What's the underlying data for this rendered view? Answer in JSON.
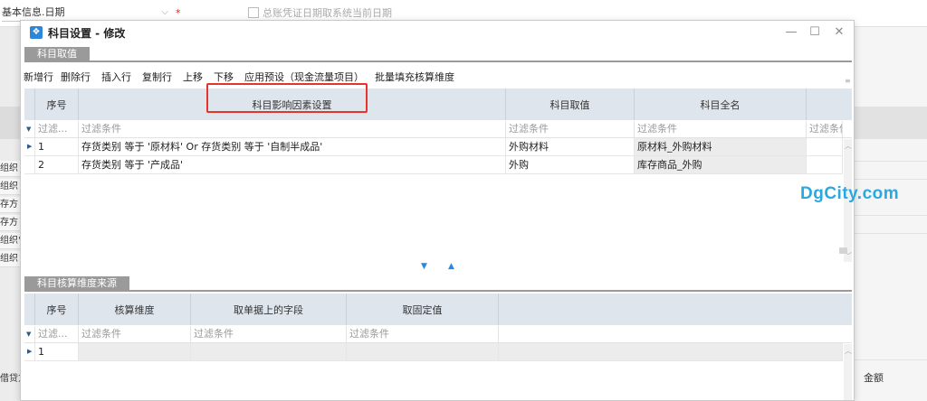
{
  "background": {
    "field_label": "基本信息.日期",
    "required_mark": "*",
    "checkbox_label": "总账凭证日期取系统当前日期",
    "left_items": [
      "组织",
      "组织",
      "存方",
      "存方",
      "组织\"",
      "组织"
    ],
    "left_bottom": "借贷方",
    "right_bottom": "金额"
  },
  "watermark": "DgCity.com",
  "dialog": {
    "title": "科目设置 - 修改",
    "controls": {
      "minimize": "—",
      "maximize": "☐",
      "close": "✕"
    }
  },
  "tab1": {
    "label": "科目取值"
  },
  "toolbar": {
    "items": [
      "新增行",
      "删除行",
      "插入行",
      "复制行",
      "上移",
      "下移",
      "应用预设（现金流量项目）",
      "批量填充核算维度"
    ]
  },
  "grid1": {
    "headers": {
      "seq": "序号",
      "factor": "科目影响因素设置",
      "value": "科目取值",
      "fullname": "科目全名"
    },
    "filter": {
      "icon": "▼",
      "seq": "过滤...",
      "factor": "过滤条件",
      "value": "过滤条件",
      "fullname": "过滤条件",
      "extra": "过滤条件"
    },
    "rows": [
      {
        "seq": "1",
        "factor": "存货类别  等于  '原材料'   Or    存货类别  等于  '自制半成品'",
        "value": "外购材料",
        "fullname": "原材料_外购材料"
      },
      {
        "seq": "2",
        "factor": "存货类别  等于  '产成品'",
        "value": "外购",
        "fullname": "库存商品_外购"
      }
    ]
  },
  "splitter": {
    "down": "▼",
    "up": "▲"
  },
  "tab2": {
    "label": "科目核算维度来源"
  },
  "grid2": {
    "headers": {
      "seq": "序号",
      "dimension": "核算维度",
      "field": "取单据上的字段",
      "fixed": "取固定值"
    },
    "filter": {
      "icon": "▼",
      "seq": "过滤...",
      "dimension": "过滤条件",
      "field": "过滤条件",
      "fixed": "过滤条件"
    },
    "rows": [
      {
        "seq": "1"
      }
    ]
  }
}
